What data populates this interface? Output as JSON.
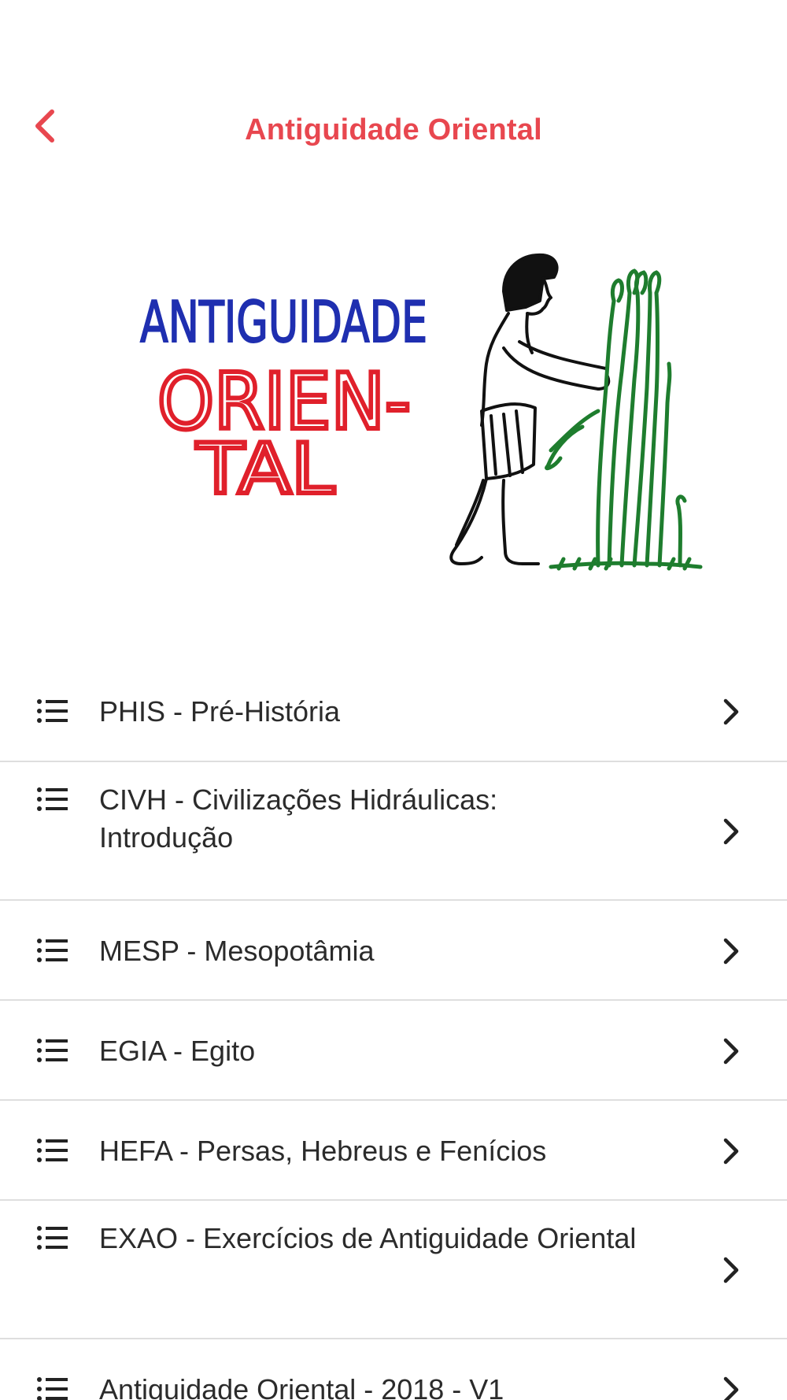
{
  "header": {
    "title": "Antiguidade Oriental",
    "back_icon": "chevron-left-icon",
    "accent_color": "#e8474f"
  },
  "hero": {
    "image_subject": "hand-drawn illustration of an ancient farmer harvesting plants",
    "lettering": {
      "line1": "ANTIGUIDADE",
      "line2": "ORIEN-",
      "line3": "TAL"
    }
  },
  "items": [
    {
      "label": "PHIS - Pré-História",
      "icon": "list-icon",
      "trailing_icon": "chevron-right-icon"
    },
    {
      "label": "CIVH - Civilizações Hidráulicas: Introdução",
      "icon": "list-icon",
      "trailing_icon": "chevron-right-icon"
    },
    {
      "label": "MESP - Mesopotâmia",
      "icon": "list-icon",
      "trailing_icon": "chevron-right-icon"
    },
    {
      "label": "EGIA - Egito",
      "icon": "list-icon",
      "trailing_icon": "chevron-right-icon"
    },
    {
      "label": "HEFA - Persas, Hebreus e Fenícios",
      "icon": "list-icon",
      "trailing_icon": "chevron-right-icon"
    },
    {
      "label": "EXAO - Exercícios de Antiguidade Oriental",
      "icon": "list-icon",
      "trailing_icon": "chevron-right-icon"
    },
    {
      "label": "Antiguidade Oriental - 2018 - V1",
      "icon": "list-icon",
      "trailing_icon": "chevron-right-icon"
    }
  ]
}
